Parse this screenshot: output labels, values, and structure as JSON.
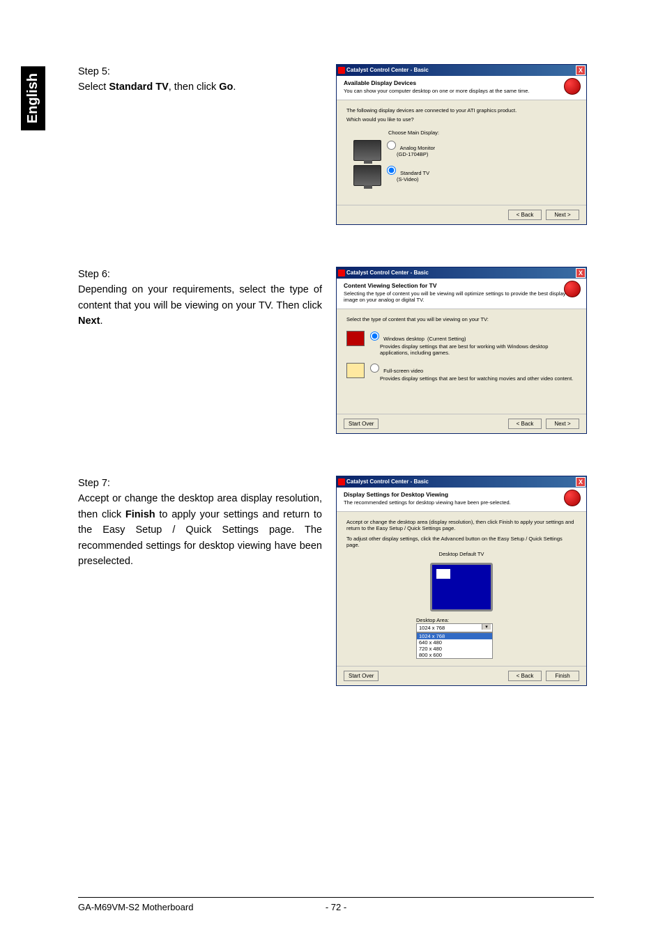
{
  "sidebar_label": "English",
  "steps": {
    "s5": {
      "label": "Step 5:",
      "line_pre": "Select ",
      "bold1": "Standard TV",
      "mid": ", then click ",
      "bold2": "Go",
      "post": "."
    },
    "s6": {
      "label": "Step 6:",
      "body_pre": "Depending on your requirements, select the type of content that you will be viewing on your TV. Then click ",
      "bold": "Next",
      "post": "."
    },
    "s7": {
      "label": "Step 7:",
      "body_pre": "Accept or change the desktop area display resolution, then click ",
      "bold": "Finish",
      "post": " to apply your settings and return to the Easy Setup / Quick Settings page. The recommended settings for desktop viewing have been preselected."
    }
  },
  "dialog_shared": {
    "title": "Catalyst Control Center - Basic",
    "close": "X",
    "back": "< Back",
    "next": "Next >",
    "start_over": "Start Over",
    "finish": "Finish"
  },
  "d1": {
    "header_title": "Available Display Devices",
    "header_sub": "You can show your computer desktop on one or more displays at the same time.",
    "body_intro": "The following display devices are connected to your ATI graphics product.",
    "body_q": "Which would you like to use?",
    "choose_label": "Choose Main Display:",
    "opt1": "Analog Monitor",
    "opt1_sub": "(GD-1704BP)",
    "opt2": "Standard TV",
    "opt2_sub": "(S-Video)"
  },
  "d2": {
    "header_title": "Content Viewing Selection for TV",
    "header_sub": "Selecting the type of content you will be viewing will optimize settings to provide the best display image on your analog or digital TV.",
    "body_intro": "Select the type of content that you will be viewing on your TV:",
    "opt1_label": "Windows desktop",
    "opt1_suffix": "(Current Setting)",
    "opt1_desc": "Provides display settings that are best for working with Windows desktop applications, including games.",
    "opt2_label": "Full-screen video",
    "opt2_desc": "Provides display settings that are best for watching movies and other video content."
  },
  "d3": {
    "header_title": "Display Settings for Desktop Viewing",
    "header_sub": "The recommended settings for desktop viewing have been pre-selected.",
    "body_l1": "Accept or change the desktop area (display resolution), then click Finish to apply your settings and return to the Easy Setup / Quick Settings page.",
    "body_l2": "To adjust other display settings, click the Advanced button on the Easy Setup / Quick Settings page.",
    "preview_label": "Desktop Default TV",
    "area_label": "Desktop Area:",
    "area_selected": "1024 x 768",
    "options": [
      "1024 x 768",
      "640 x 480",
      "720 x 480",
      "800 x 600"
    ]
  },
  "footer": {
    "left": "GA-M69VM-S2 Motherboard",
    "center": "- 72 -"
  }
}
